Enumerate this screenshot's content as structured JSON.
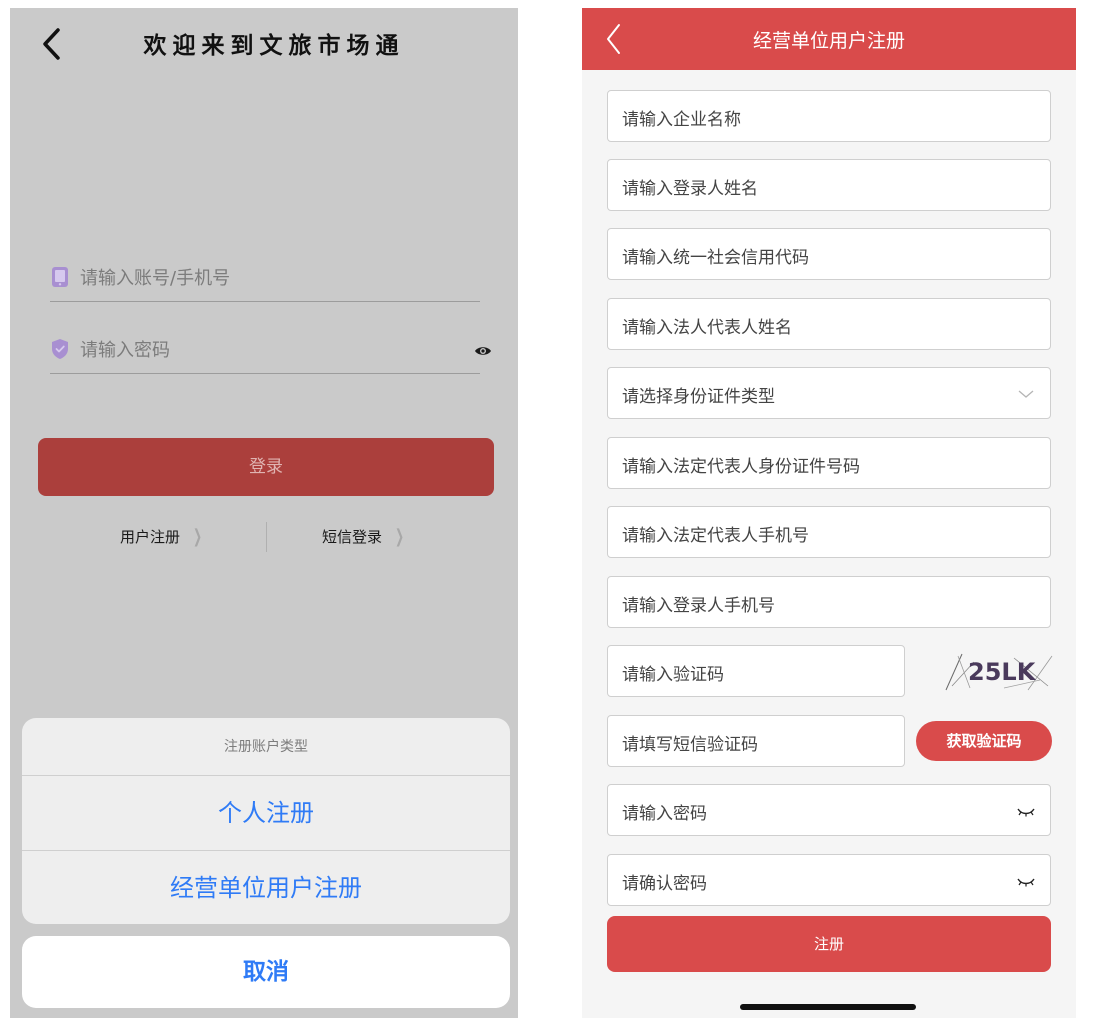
{
  "left": {
    "title": "欢迎来到文旅市场通",
    "account_placeholder": "请输入账号/手机号",
    "password_placeholder": "请输入密码",
    "login_label": "登录",
    "register_link": "用户注册",
    "sms_login_link": "短信登录",
    "sheet": {
      "title": "注册账户类型",
      "options": [
        "个人注册",
        "经营单位用户注册"
      ],
      "cancel": "取消"
    }
  },
  "right": {
    "title": "经营单位用户注册",
    "fields": [
      "请输入企业名称",
      "请输入登录人姓名",
      "请输入统一社会信用代码",
      "请输入法人代表人姓名",
      "请选择身份证件类型",
      "请输入法定代表人身份证件号码",
      "请输入法定代表人手机号",
      "请输入登录人手机号",
      "请输入验证码",
      "请填写短信验证码",
      "请输入密码",
      "请确认密码"
    ],
    "captcha_text": "25LK",
    "sms_button": "获取验证码",
    "submit_label": "注册"
  },
  "colors": {
    "accent_red": "#d94b4b",
    "dimmed_red": "#ab3f3c",
    "ios_blue": "#2f7bf6"
  },
  "icons": [
    "back-chevron-icon",
    "phone-icon",
    "shield-icon",
    "eye-icon",
    "chevron-right-icon",
    "dropdown-chevron-icon",
    "eye-closed-icon"
  ]
}
